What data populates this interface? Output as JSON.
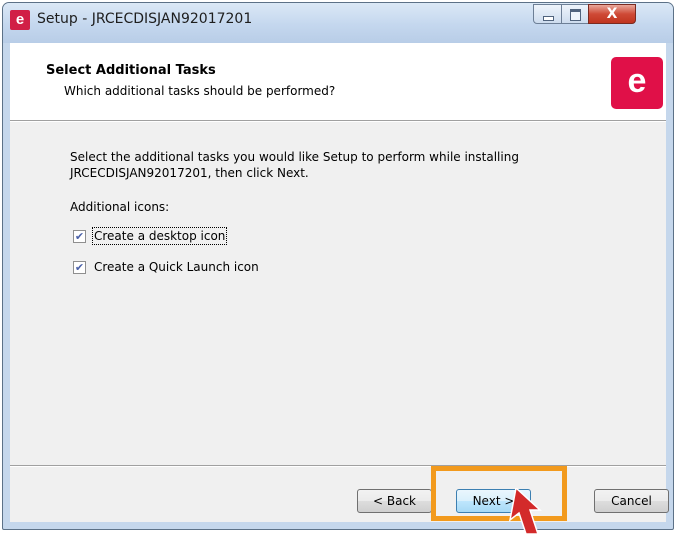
{
  "window": {
    "title": "Setup - JRCECDISJAN92017201",
    "app_icon_glyph": "e",
    "close_glyph": "X"
  },
  "header": {
    "title": "Select Additional Tasks",
    "subtitle": "Which additional tasks should be performed?",
    "logo_glyph": "e"
  },
  "body": {
    "description": "Select the additional tasks you would like Setup to perform while installing JRCECDISJAN92017201, then click Next.",
    "section_label": "Additional icons:",
    "tasks": [
      {
        "label": "Create a desktop icon",
        "checked": true
      },
      {
        "label": "Create a Quick Launch icon",
        "checked": true
      }
    ]
  },
  "buttons": {
    "back": "< Back",
    "next": "Next >",
    "cancel": "Cancel"
  },
  "colors": {
    "accent": "#e01048",
    "highlight": "#f29a1d",
    "pointer": "#d32a2a"
  },
  "icons": {
    "app": "app-logo-icon",
    "minimize": "minimize-icon",
    "maximize": "maximize-icon",
    "close": "close-icon",
    "checkbox": "checkmark-icon",
    "pointer": "arrow-pointer-icon"
  }
}
